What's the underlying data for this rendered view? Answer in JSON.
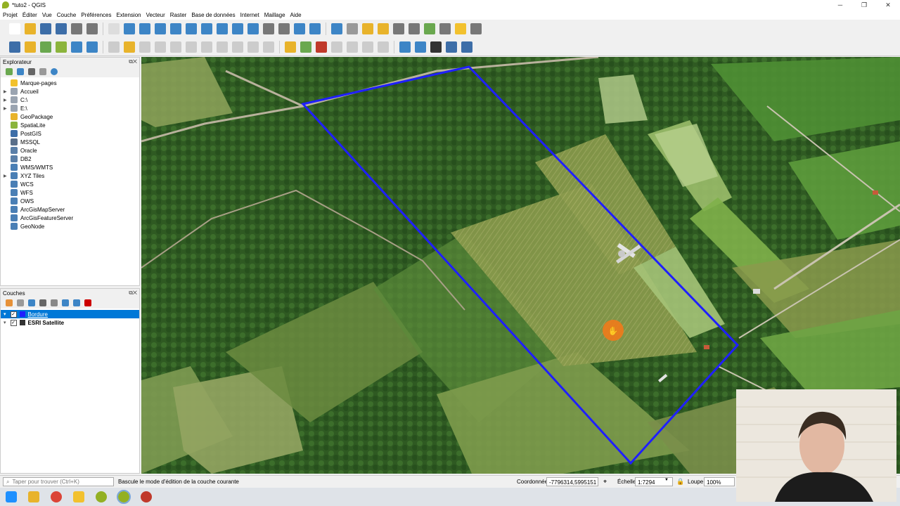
{
  "window": {
    "title": "*tuto2 - QGIS"
  },
  "menu": [
    "Projet",
    "Éditer",
    "Vue",
    "Couche",
    "Préférences",
    "Extension",
    "Vecteur",
    "Raster",
    "Base de données",
    "Internet",
    "Maillage",
    "Aide"
  ],
  "browser": {
    "title": "Explorateur",
    "items": [
      {
        "label": "Marque-pages",
        "expandable": false,
        "icon": "star-icon",
        "color": "#f2c12e"
      },
      {
        "label": "Accueil",
        "expandable": true,
        "icon": "home-folder-icon",
        "color": "#9aa4b1"
      },
      {
        "label": "C:\\",
        "expandable": true,
        "icon": "drive-icon",
        "color": "#9aa4b1"
      },
      {
        "label": "E:\\",
        "expandable": true,
        "icon": "drive-icon",
        "color": "#9aa4b1"
      },
      {
        "label": "GeoPackage",
        "expandable": false,
        "icon": "geopackage-icon",
        "color": "#e8b32b"
      },
      {
        "label": "SpatiaLite",
        "expandable": false,
        "icon": "spatialite-icon",
        "color": "#8bb43c"
      },
      {
        "label": "PostGIS",
        "expandable": false,
        "icon": "postgis-icon",
        "color": "#3d6ea8"
      },
      {
        "label": "MSSQL",
        "expandable": false,
        "icon": "mssql-icon",
        "color": "#5a6f8a"
      },
      {
        "label": "Oracle",
        "expandable": false,
        "icon": "oracle-icon",
        "color": "#5a7fa8"
      },
      {
        "label": "DB2",
        "expandable": false,
        "icon": "db2-icon",
        "color": "#5a7fa8"
      },
      {
        "label": "WMS/WMTS",
        "expandable": false,
        "icon": "globe-icon",
        "color": "#4a7fb5"
      },
      {
        "label": "XYZ Tiles",
        "expandable": true,
        "icon": "xyz-tiles-icon",
        "color": "#4a7fb5"
      },
      {
        "label": "WCS",
        "expandable": false,
        "icon": "globe-icon",
        "color": "#4a7fb5"
      },
      {
        "label": "WFS",
        "expandable": false,
        "icon": "globe-icon",
        "color": "#4a7fb5"
      },
      {
        "label": "OWS",
        "expandable": false,
        "icon": "globe-icon",
        "color": "#4a7fb5"
      },
      {
        "label": "ArcGisMapServer",
        "expandable": false,
        "icon": "arcgis-icon",
        "color": "#4a7fb5"
      },
      {
        "label": "ArcGisFeatureServer",
        "expandable": false,
        "icon": "arcgis-icon",
        "color": "#4a7fb5"
      },
      {
        "label": "GeoNode",
        "expandable": false,
        "icon": "geonode-icon",
        "color": "#4a7fb5"
      }
    ]
  },
  "layers": {
    "title": "Couches",
    "items": [
      {
        "label": "Bordure",
        "checked": true,
        "selected": true
      },
      {
        "label": "ESRI Satellite",
        "checked": true,
        "selected": false
      }
    ]
  },
  "status": {
    "locator_placeholder": "Taper pour trouver (Ctrl+K)",
    "message": "Bascule le mode d'édition de la couche courante",
    "coord_label": "Coordonnée",
    "coord_value": "-7796314,5995151",
    "scale_label": "Échelle",
    "scale_value": "1:7294",
    "magnifier_label": "Loupe",
    "magnifier_value": "100%"
  },
  "colors": {
    "polygon": "#1f1fff",
    "selection": "#0078d7",
    "cursor": "#f07a1a"
  }
}
